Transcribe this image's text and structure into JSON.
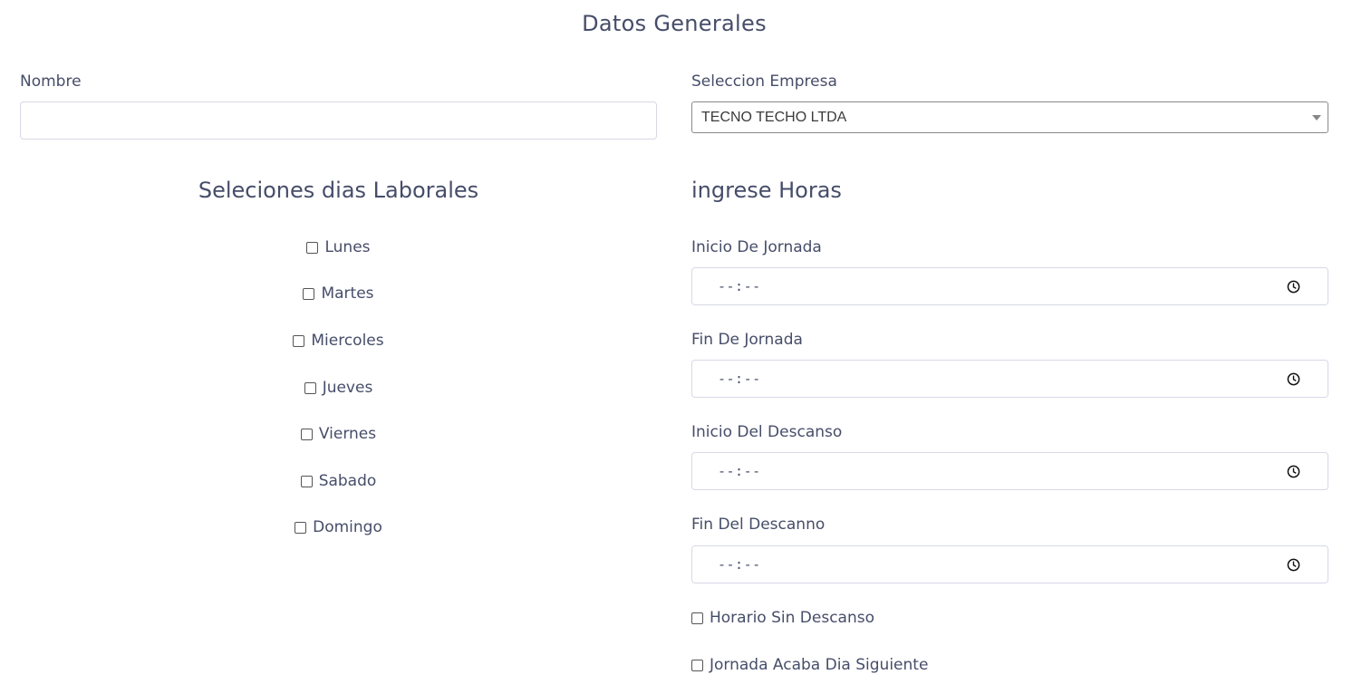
{
  "header": {
    "title": "Datos Generales"
  },
  "nombre": {
    "label": "Nombre",
    "value": "",
    "placeholder": ""
  },
  "empresa": {
    "label": "Seleccion Empresa",
    "selected": "TECNO TECHO LTDA"
  },
  "dias": {
    "title": "Seleciones dias Laborales",
    "items": [
      {
        "label": "Lunes",
        "checked": false
      },
      {
        "label": "Martes",
        "checked": false
      },
      {
        "label": "Miercoles",
        "checked": false
      },
      {
        "label": "Jueves",
        "checked": false
      },
      {
        "label": "Viernes",
        "checked": false
      },
      {
        "label": "Sabado",
        "checked": false
      },
      {
        "label": "Domingo",
        "checked": false
      }
    ]
  },
  "horas": {
    "title": "ingrese Horas",
    "fields": [
      {
        "label": "Inicio De Jornada",
        "value": "--:--"
      },
      {
        "label": "Fin De Jornada",
        "value": "--:--"
      },
      {
        "label": "Inicio Del Descanso",
        "value": "--:--"
      },
      {
        "label": "Fin Del Descanno",
        "value": "--:--"
      }
    ],
    "options": [
      {
        "label": "Horario Sin Descanso",
        "checked": false
      },
      {
        "label": "Jornada Acaba Dia Siguiente",
        "checked": false
      }
    ]
  },
  "icons": {
    "clock": "clock-icon",
    "dropdown": "chevron-down-icon"
  },
  "colors": {
    "text": "#464d69",
    "input_border": "#d7d9e6"
  }
}
